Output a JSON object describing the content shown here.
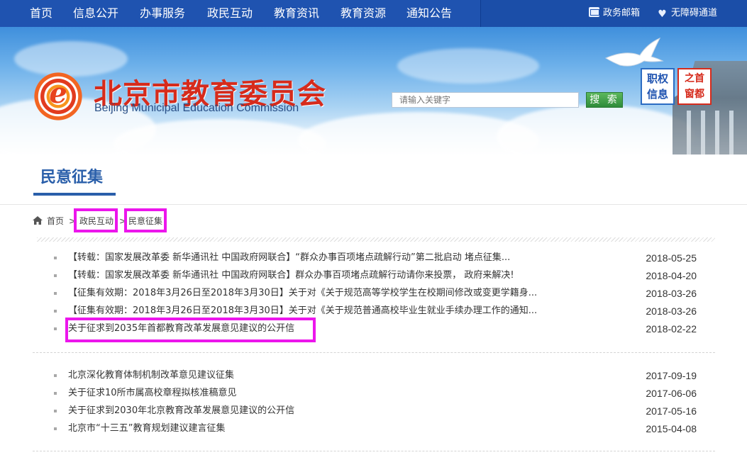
{
  "topnav": {
    "items": [
      "首页",
      "信息公开",
      "办事服务",
      "政民互动",
      "教育资讯",
      "教育资源",
      "通知公告"
    ],
    "right": [
      {
        "label": "政务邮箱",
        "icon": "mail-icon"
      },
      {
        "label": "无障碍通道",
        "icon": "heart-icon"
      }
    ]
  },
  "banner": {
    "title": "北京市教育委员会",
    "subtitle": "Beijing Municipal Education Commission",
    "search_placeholder": "请输入关键字",
    "search_button": "搜 索",
    "tag_zhiquan": [
      "职权",
      "信息"
    ],
    "tag_shoudu": [
      "之首",
      "窗都"
    ]
  },
  "section": {
    "title": "民意征集"
  },
  "breadcrumb": {
    "home": "首页",
    "sep": ">",
    "level1": "政民互动",
    "level2": "民意征集"
  },
  "list1": [
    {
      "title": "【转载：国家发展改革委 新华通讯社 中国政府网联合】“群众办事百项堵点疏解行动”第二批启动 堵点征集...",
      "date": "2018-05-25"
    },
    {
      "title": "【转载：国家发展改革委 新华通讯社 中国政府网联合】群众办事百项堵点疏解行动请你来投票， 政府来解决!",
      "date": "2018-04-20"
    },
    {
      "title": "【征集有效期：2018年3月26日至2018年3月30日】关于对《关于规范高等学校学生在校期间修改或变更学籍身...",
      "date": "2018-03-26"
    },
    {
      "title": "【征集有效期：2018年3月26日至2018年3月30日】关于对《关于规范普通高校毕业生就业手续办理工作的通知...",
      "date": "2018-03-26"
    },
    {
      "title": "关于征求到2035年首都教育改革发展意见建议的公开信",
      "date": "2018-02-22"
    }
  ],
  "list2": [
    {
      "title": "北京深化教育体制机制改革意见建议征集",
      "date": "2017-09-19"
    },
    {
      "title": "关于征求10所市属高校章程拟核准稿意见",
      "date": "2017-06-06"
    },
    {
      "title": "关于征求到2030年北京教育改革发展意见建议的公开信",
      "date": "2017-05-16"
    },
    {
      "title": "北京市“十三五”教育规划建议建言征集",
      "date": "2015-04-08"
    }
  ],
  "colors": {
    "nav": "#1f53b0",
    "title_red": "#d62b1c",
    "accent_blue": "#2a5faa",
    "highlight": "#ec16ec"
  }
}
